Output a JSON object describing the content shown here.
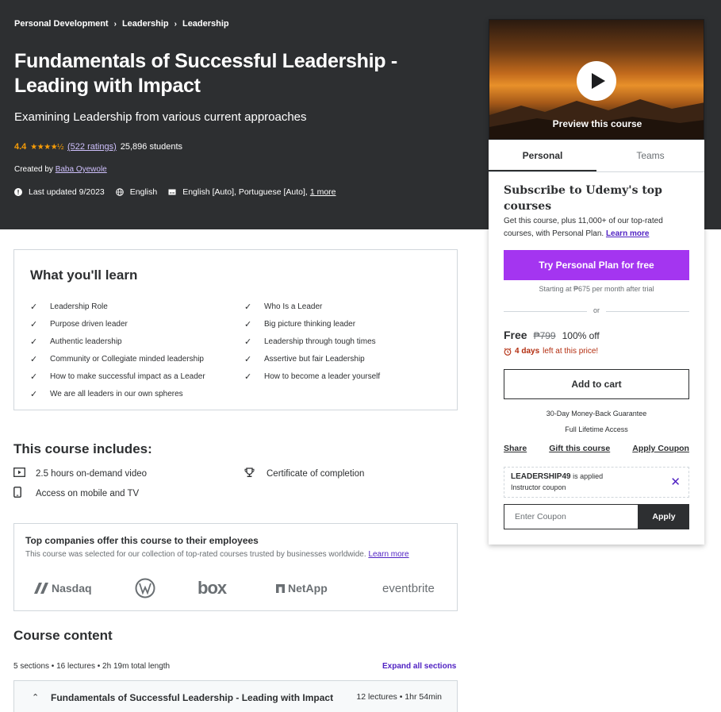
{
  "breadcrumbs": [
    "Personal Development",
    "Leadership",
    "Leadership"
  ],
  "course": {
    "title": "Fundamentals of Successful Leadership - Leading with Impact",
    "subtitle": "Examining Leadership from various current approaches",
    "rating": "4.4",
    "stars": "★★★★½",
    "ratings_count": "(522 ratings)",
    "students": "25,896 students",
    "created_by_label": "Created by",
    "author": "Baba Oyewole",
    "last_updated": "Last updated 9/2023",
    "language": "English",
    "captions": "English [Auto], Portuguese [Auto],",
    "captions_more": "1 more"
  },
  "sidebar": {
    "preview_label": "Preview this course",
    "tabs": [
      "Personal",
      "Teams"
    ],
    "subscribe_title": "Subscribe to Udemy's top courses",
    "subscribe_desc": "Get this course, plus 11,000+ of our top-rated courses, with Personal Plan.",
    "learn_more": "Learn more",
    "plan_button": "Try Personal Plan for free",
    "plan_note": "Starting at ₱675 per month after trial",
    "or": "or",
    "price_free": "Free",
    "price_old": "₱799",
    "price_off": "100% off",
    "timer_bold": "4 days",
    "timer_rest": "left at this price!",
    "add_to_cart": "Add to cart",
    "guarantee": "30-Day Money-Back Guarantee",
    "lifetime": "Full Lifetime Access",
    "share": "Share",
    "gift": "Gift this course",
    "apply_coupon": "Apply Coupon",
    "coupon_code": "LEADERSHIP49",
    "coupon_applied": "is applied",
    "coupon_type": "Instructor coupon",
    "coupon_placeholder": "Enter Coupon",
    "coupon_apply_button": "Apply"
  },
  "learn": {
    "heading": "What you'll learn",
    "left": [
      "Leadership Role",
      "Purpose driven leader",
      "Authentic leadership",
      "Community or Collegiate minded leadership",
      "How to make successful impact as a Leader",
      "We are all leaders in our own spheres"
    ],
    "right": [
      "Who Is a Leader",
      "Big picture thinking leader",
      "Leadership through tough times",
      "Assertive but fair Leadership",
      "How to become a leader yourself"
    ]
  },
  "includes": {
    "heading": "This course includes:",
    "video": "2.5 hours on-demand video",
    "mobile": "Access on mobile and TV",
    "certificate": "Certificate of completion"
  },
  "companies": {
    "heading": "Top companies offer this course to their employees",
    "desc": "This course was selected for our collection of top-rated courses trusted by businesses worldwide.",
    "learn_more": "Learn more",
    "logos": [
      "Nasdaq",
      "box",
      "NetApp",
      "eventbrite"
    ]
  },
  "content": {
    "heading": "Course content",
    "meta": "5 sections • 16 lectures • 2h 19m total length",
    "expand_all": "Expand all sections",
    "section_title": "Fundamentals of Successful Leadership - Leading with Impact",
    "section_meta": "12 lectures • 1hr 54min"
  }
}
